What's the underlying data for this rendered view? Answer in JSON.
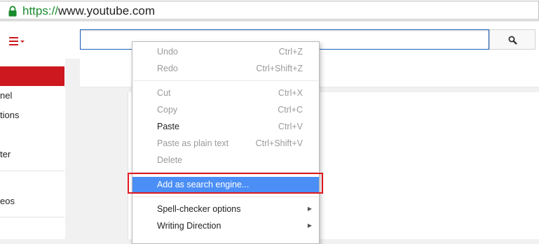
{
  "omnibox": {
    "url_scheme": "https://",
    "url_host": "www.youtube.com"
  },
  "masthead": {
    "guide_icon": "hamburger-menu-icon",
    "search_placeholder": "",
    "search_icon": "magnifier-icon"
  },
  "sidebar": {
    "items": [
      {
        "label": "nel"
      },
      {
        "label": "tions"
      },
      {
        "label": "ter"
      },
      {
        "label": "eos"
      }
    ]
  },
  "context_menu": {
    "groups": [
      [
        {
          "label": "Undo",
          "shortcut": "Ctrl+Z",
          "enabled": false
        },
        {
          "label": "Redo",
          "shortcut": "Ctrl+Shift+Z",
          "enabled": false
        }
      ],
      [
        {
          "label": "Cut",
          "shortcut": "Ctrl+X",
          "enabled": false
        },
        {
          "label": "Copy",
          "shortcut": "Ctrl+C",
          "enabled": false
        },
        {
          "label": "Paste",
          "shortcut": "Ctrl+V",
          "enabled": true
        },
        {
          "label": "Paste as plain text",
          "shortcut": "Ctrl+Shift+V",
          "enabled": false
        },
        {
          "label": "Delete",
          "shortcut": "",
          "enabled": false
        }
      ],
      [
        {
          "label": "Add as search engine...",
          "shortcut": "",
          "enabled": true,
          "highlighted": true
        }
      ],
      [
        {
          "label": "Spell-checker options",
          "submenu": true,
          "enabled": true
        },
        {
          "label": "Writing Direction",
          "submenu": true,
          "enabled": true
        }
      ]
    ]
  },
  "colors": {
    "highlight": "#4b8ef6",
    "annotation_box": "#e0191f",
    "youtube_red": "#cc181e",
    "secure_green": "#1a8b2e"
  }
}
